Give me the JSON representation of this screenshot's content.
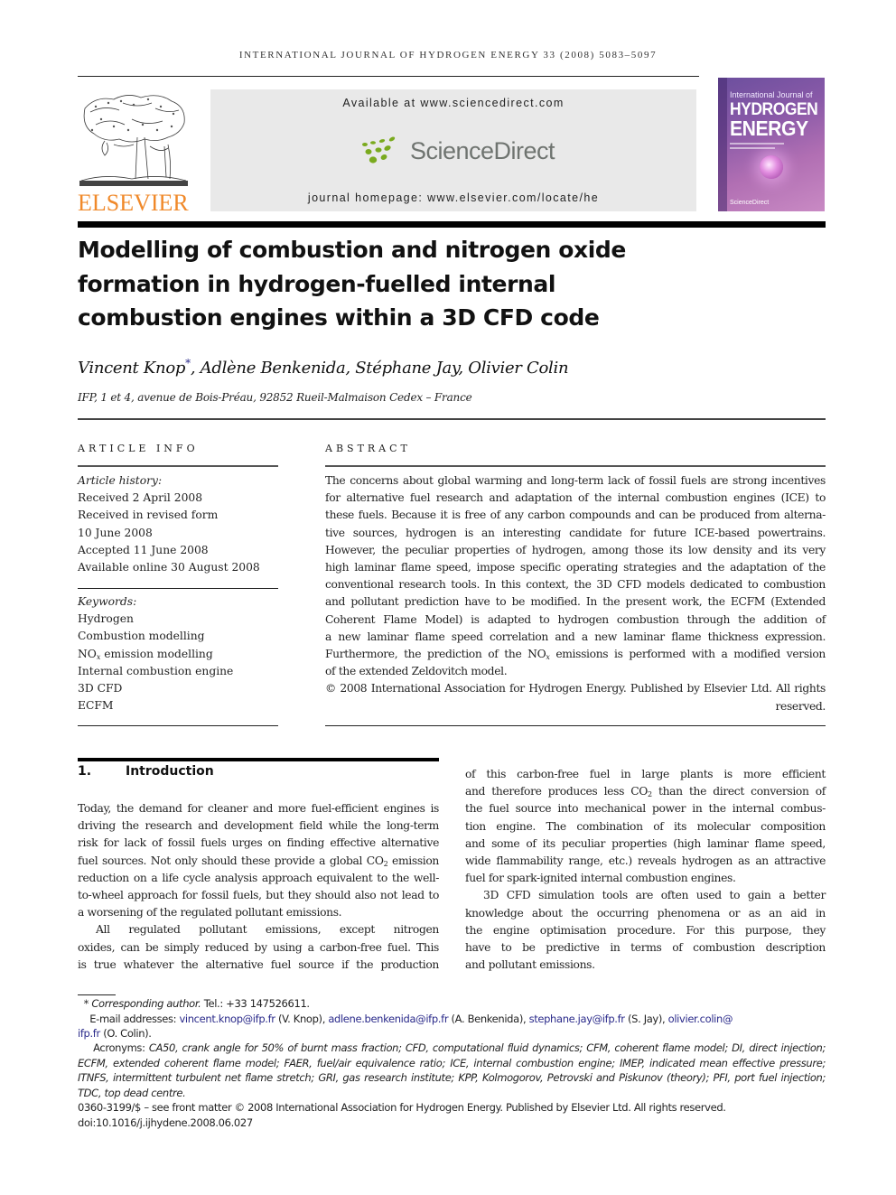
{
  "running_head": "INTERNATIONAL JOURNAL OF HYDROGEN ENERGY 33 (2008) 5083–5097",
  "masthead": {
    "publisher_logo": "ELSEVIER",
    "available_at": "Available at www.sciencedirect.com",
    "platform_logo": "ScienceDirect",
    "homepage": "journal homepage: www.elsevier.com/locate/he",
    "cover": {
      "line1": "International Journal of",
      "line2": "HYDROGEN",
      "line3": "ENERGY",
      "footer": "ScienceDirect"
    },
    "colors": {
      "elsevier_orange": "#f0892a",
      "sd_green": "#7aaa1e",
      "sd_gray": "#6f7470",
      "box_gray": "#e9e9e9"
    }
  },
  "article": {
    "title_lines": [
      "Modelling of combustion and nitrogen oxide",
      "formation in hydrogen-fuelled internal",
      "combustion engines within a 3D CFD code"
    ],
    "authors": [
      {
        "name": "Vincent Knop",
        "mark": "*"
      },
      {
        "name": "Adlène Benkenida"
      },
      {
        "name": "Stéphane Jay"
      },
      {
        "name": "Olivier Colin"
      }
    ],
    "affiliation": "IFP, 1 et 4, avenue de Bois-Préau, 92852 Rueil-Malmaison Cedex – France"
  },
  "article_info": {
    "label": "ARTICLE INFO",
    "history_label": "Article history:",
    "history": [
      "Received 2 April 2008",
      "Received in revised form",
      "10 June 2008",
      "Accepted 11 June 2008",
      "Available online 30 August 2008"
    ],
    "keywords_label": "Keywords:",
    "keywords": [
      "Hydrogen",
      "Combustion modelling",
      {
        "base": "NO",
        "sub": "x",
        "rest": " emission modelling"
      },
      "Internal combustion engine",
      "3D CFD",
      "ECFM"
    ]
  },
  "abstract": {
    "label": "ABSTRACT",
    "lines": [
      "The concerns about global warming and long-term lack of fossil fuels are strong incentives",
      "for alternative fuel research and adaptation of the internal combustion engines (ICE) to",
      "these fuels. Because it is free of any carbon compounds and can be produced from alterna-",
      "tive sources, hydrogen is an interesting candidate for future ICE-based powertrains.",
      "However, the peculiar properties of hydrogen, among those its low density and its very",
      "high laminar flame speed, impose specific operating strategies and the adaptation of the",
      "conventional research tools. In this context, the 3D CFD models dedicated to combustion",
      "and pollutant prediction have to be modified. In the present work, the ECFM (Extended",
      "Coherent Flame Model) is adapted to hydrogen combustion through the addition of",
      "a new laminar flame speed correlation and a new laminar flame thickness expression."
    ],
    "line_nox_before": "Furthermore, the prediction of the NO",
    "line_nox_sub": "x",
    "line_nox_after": " emissions is performed with a modified version",
    "last_line": "of the extended Zeldovitch model.",
    "copyright_line1": "© 2008 International Association for Hydrogen Energy. Published by Elsevier Ltd. All rights",
    "copyright_line2": "reserved."
  },
  "introduction": {
    "number": "1.",
    "heading": "Introduction",
    "left_column": {
      "p1_lines": [
        "Today, the demand for cleaner and more fuel-efficient engines is",
        "driving the research and development field while the long-term",
        "risk for lack of fossil fuels urges on finding effective alternative"
      ],
      "p1_co2_before": "fuel sources. Not only should these provide a global CO",
      "p1_co2_sub": "2",
      "p1_co2_after": " emission",
      "p1_rest": [
        "reduction on a life cycle analysis approach equivalent to the well-",
        "to-wheel approach for fossil fuels, but they should also not lead to"
      ],
      "p1_last": "a worsening of the regulated pollutant emissions.",
      "p2_lines": [
        "All regulated pollutant emissions, except nitrogen",
        "oxides, can be simply reduced by using a carbon-free fuel. This",
        "is true whatever the alternative fuel source if the production"
      ]
    },
    "right_column": {
      "p1_first": "of this carbon-free fuel in large plants is more efficient",
      "p1_co2_before": "and therefore produces less CO",
      "p1_co2_sub": "2",
      "p1_co2_after": " than the direct conversion of",
      "p1_lines": [
        "the fuel source into mechanical power in the internal combus-",
        "tion engine. The combination of its molecular composition",
        "and some of its peculiar properties (high laminar flame speed,",
        "wide flammability range, etc.) reveals hydrogen as an attractive"
      ],
      "p1_last": "fuel for spark-ignited internal combustion engines.",
      "p2_lines": [
        "3D CFD simulation tools are often used to gain a better",
        "knowledge about the occurring phenomena or as an aid in",
        "the engine optimisation procedure. For this purpose, they",
        "have to be predictive in terms of combustion description"
      ],
      "p2_last": "and pollutant emissions."
    }
  },
  "footnotes": {
    "corresponding_mark": "*",
    "corresponding_label": "Corresponding author.",
    "tel": " Tel.: +33 147526611.",
    "email_label": "E-mail addresses: ",
    "emails": [
      {
        "address": "vincent.knop@ifp.fr",
        "who": " (V. Knop), "
      },
      {
        "address": "adlene.benkenida@ifp.fr",
        "who": " (A. Benkenida), "
      },
      {
        "address": "stephane.jay@ifp.fr",
        "who": " (S. Jay), "
      }
    ],
    "last_email_part1": "olivier.colin@",
    "last_email_part2": "ifp.fr",
    "last_email_who": " (O. Colin).",
    "acronyms_label": "Acronyms:",
    "acronyms_lines": [
      " CA50, crank angle for 50% of burnt mass fraction; CFD, computational fluid dynamics; CFM, coherent flame model; DI, direct injection;",
      "ECFM, extended coherent flame model; FAER, fuel/air equivalence ratio; ICE, internal combustion engine; IMEP, indicated mean effective pressure;",
      "ITNFS, intermittent turbulent net flame stretch; GRI, gas research institute; KPP, Kolmogorov, Petrovski and Piskunov (theory); PFI, port fuel injection;",
      "TDC, top dead centre."
    ],
    "front_matter": "0360-3199/$ – see front matter © 2008 International Association for Hydrogen Energy. Published by Elsevier Ltd. All rights reserved.",
    "doi": "doi:10.1016/j.ijhydene.2008.06.027"
  }
}
